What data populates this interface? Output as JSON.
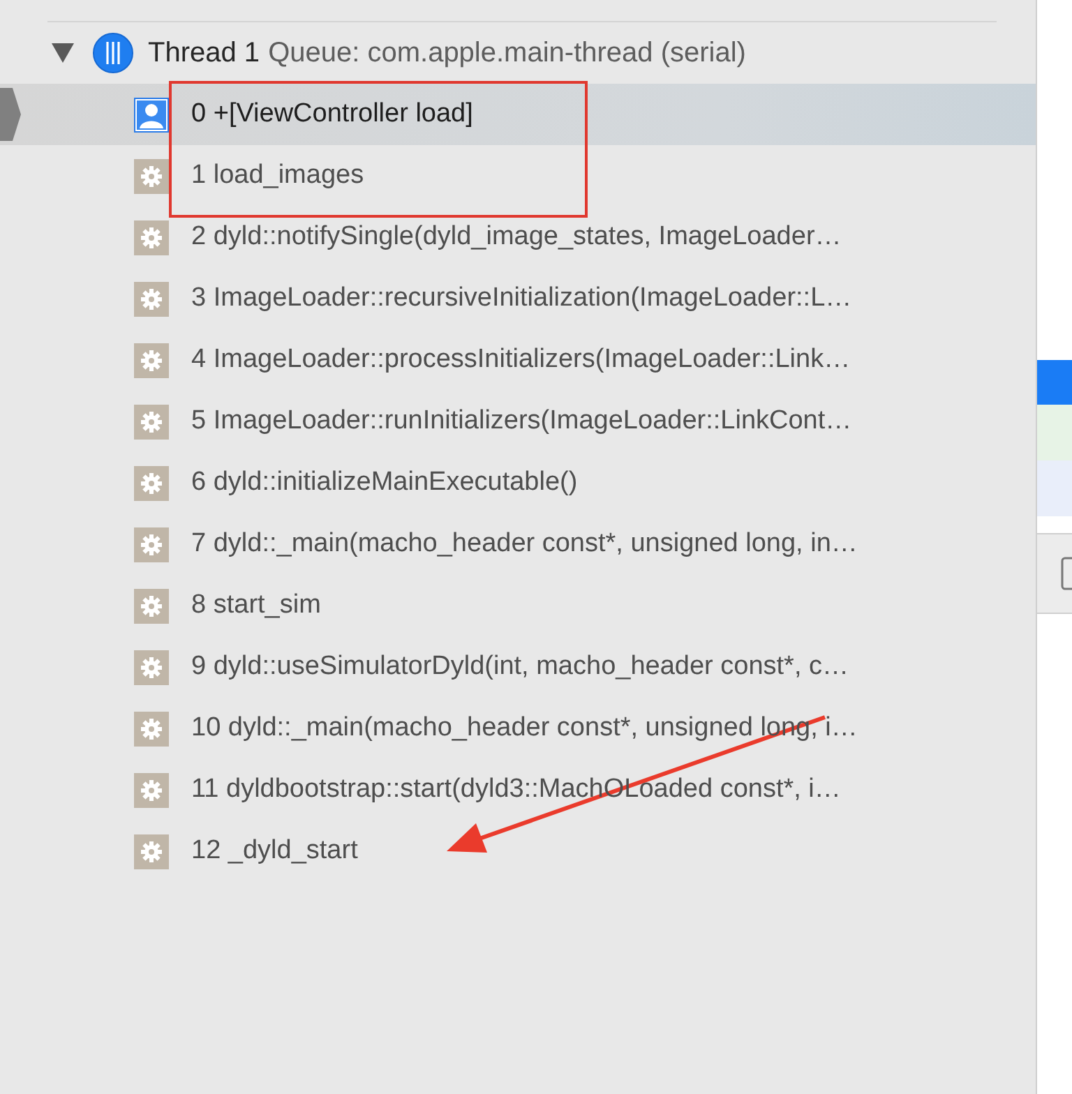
{
  "thread": {
    "title": "Thread 1",
    "queue": "Queue: com.apple.main-thread (serial)",
    "expanded": true
  },
  "frames": [
    {
      "text": "0 +[ViewController load]",
      "kind": "user",
      "selected": true,
      "boxed": true
    },
    {
      "text": "1 load_images",
      "kind": "system",
      "selected": false,
      "boxed": true
    },
    {
      "text": "2 dyld::notifySingle(dyld_image_states, ImageLoader…",
      "kind": "system",
      "selected": false
    },
    {
      "text": "3 ImageLoader::recursiveInitialization(ImageLoader::L…",
      "kind": "system",
      "selected": false
    },
    {
      "text": "4 ImageLoader::processInitializers(ImageLoader::Link…",
      "kind": "system",
      "selected": false
    },
    {
      "text": "5 ImageLoader::runInitializers(ImageLoader::LinkCont…",
      "kind": "system",
      "selected": false
    },
    {
      "text": "6 dyld::initializeMainExecutable()",
      "kind": "system",
      "selected": false
    },
    {
      "text": "7 dyld::_main(macho_header const*, unsigned long, in…",
      "kind": "system",
      "selected": false
    },
    {
      "text": "8 start_sim",
      "kind": "system",
      "selected": false
    },
    {
      "text": "9 dyld::useSimulatorDyld(int, macho_header const*, c…",
      "kind": "system",
      "selected": false
    },
    {
      "text": "10 dyld::_main(macho_header const*, unsigned long, i…",
      "kind": "system",
      "selected": false
    },
    {
      "text": "11 dyldbootstrap::start(dyld3::MachOLoaded const*, i…",
      "kind": "system",
      "selected": false
    },
    {
      "text": "12 _dyld_start",
      "kind": "system",
      "selected": false,
      "arrow": true
    }
  ]
}
